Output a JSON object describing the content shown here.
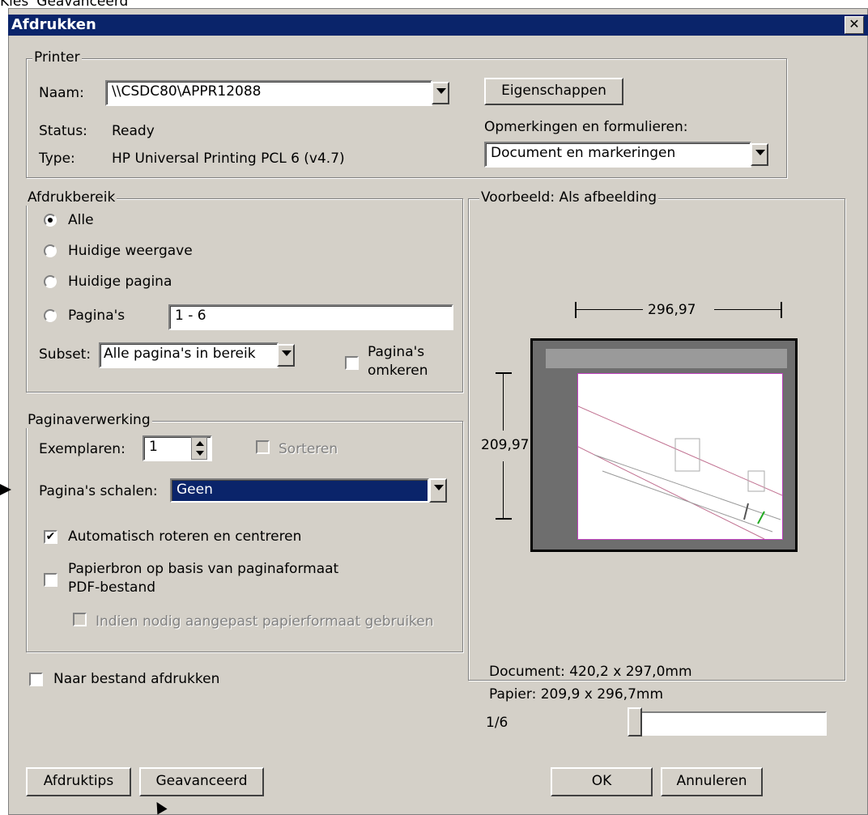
{
  "caption": "Kies 'Geavanceerd'",
  "window": {
    "title": "Afdrukken",
    "close": "✕"
  },
  "printer": {
    "legend": "Printer",
    "naam_label": "Naam:",
    "naam_value": "\\\\CSDC80\\APPR12088",
    "status_label": "Status:",
    "status_value": "Ready",
    "type_label": "Type:",
    "type_value": "HP Universal Printing PCL 6 (v4.7)",
    "properties_button": "Eigenschappen",
    "comments_label": "Opmerkingen en formulieren:",
    "comments_value": "Document en markeringen"
  },
  "range": {
    "legend": "Afdrukbereik",
    "options": [
      "Alle",
      "Huidige weergave",
      "Huidige pagina",
      "Pagina's"
    ],
    "selected": "Alle",
    "pages_value": "1 - 6",
    "subset_label": "Subset:",
    "subset_value": "Alle pagina's in bereik",
    "reverse_label_1": "Pagina's",
    "reverse_label_2": "omkeren"
  },
  "handling": {
    "legend": "Paginaverwerking",
    "copies_label": "Exemplaren:",
    "copies_value": "1",
    "collate_label": "Sorteren",
    "scale_label": "Pagina's schalen:",
    "scale_value": "Geen",
    "auto_rotate_label": "Automatisch roteren en centreren",
    "paper_source_label_1": "Papierbron op basis van paginaformaat",
    "paper_source_label_2": "PDF-bestand",
    "custom_paper_label": "Indien nodig aangepast papierformaat gebruiken"
  },
  "preview": {
    "legend": "Voorbeeld: Als afbeelding",
    "width_dim": "296,97",
    "height_dim": "209,97",
    "document_info": "Document: 420,2 x 297,0mm",
    "paper_info": "Papier: 209,9 x 296,7mm",
    "page_counter": "1/6",
    "slider_position": 0
  },
  "print_to_file_label": "Naar bestand afdrukken",
  "buttons": {
    "tips": "Afdruktips",
    "advanced": "Geavanceerd",
    "ok": "OK",
    "cancel": "Annuleren"
  }
}
